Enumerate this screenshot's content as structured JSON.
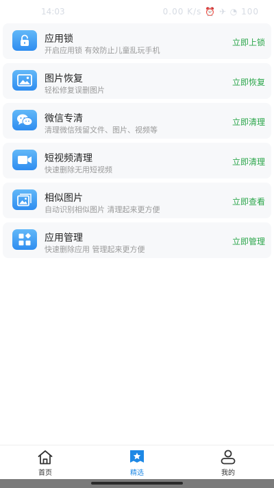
{
  "status_bar": {
    "time": "14:03",
    "right_text": "0.00 K/s ⏰ ✈ ◔ 100"
  },
  "features": [
    {
      "icon": "lock-icon",
      "title": "应用锁",
      "desc": "开启应用锁 有效防止儿童乱玩手机",
      "action": "立即上锁"
    },
    {
      "icon": "picture-icon",
      "title": "图片恢复",
      "desc": "轻松修复误删图片",
      "action": "立即恢复"
    },
    {
      "icon": "wechat-icon",
      "title": "微信专清",
      "desc": "清理微信残留文件、图片、视频等",
      "action": "立即清理"
    },
    {
      "icon": "video-camera-icon",
      "title": "短视频清理",
      "desc": "快速删除无用短视频",
      "action": "立即清理"
    },
    {
      "icon": "similar-photos-icon",
      "title": "相似图片",
      "desc": "自动识别相似图片 清理起来更方便",
      "action": "立即查看"
    },
    {
      "icon": "apps-grid-icon",
      "title": "应用管理",
      "desc": "快速删除应用 管理起来更方便",
      "action": "立即管理"
    }
  ],
  "bottom_nav": {
    "home_label": "首页",
    "featured_label": "精选",
    "mine_label": "我的"
  },
  "colors": {
    "accent_green": "#2ba64a",
    "icon_blue": "#2f8df0",
    "nav_active": "#1e88e5",
    "card_bg": "#f7f8fa"
  }
}
